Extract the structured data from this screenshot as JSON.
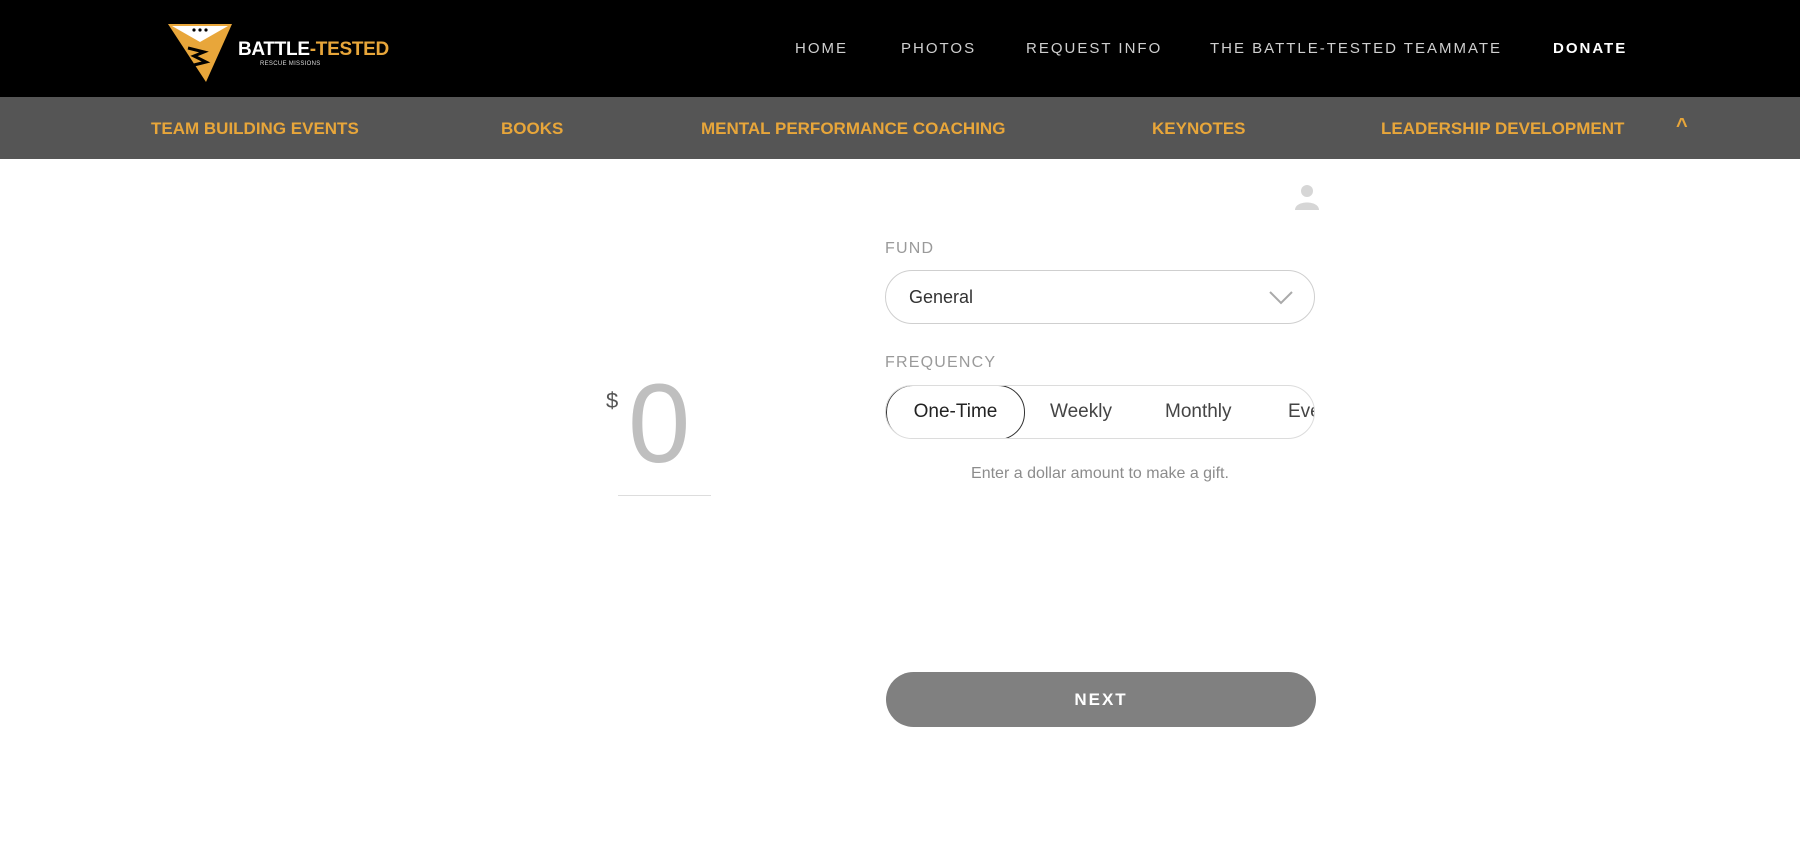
{
  "brand": {
    "name_part1": "BATTLE",
    "name_part2": "-TESTED",
    "tagline_part1": "RESCUE MISSIONS",
    "tagline_part2": ""
  },
  "main_nav": {
    "items": [
      {
        "label": "HOME"
      },
      {
        "label": "PHOTOS"
      },
      {
        "label": "REQUEST INFO"
      },
      {
        "label": "THE BATTLE-TESTED TEAMMATE"
      },
      {
        "label": "DONATE"
      }
    ]
  },
  "sub_nav": {
    "items": [
      {
        "label": "TEAM BUILDING EVENTS"
      },
      {
        "label": "BOOKS"
      },
      {
        "label": "MENTAL PERFORMANCE COACHING"
      },
      {
        "label": "KEYNOTES"
      },
      {
        "label": "LEADERSHIP DEVELOPMENT"
      }
    ],
    "caret": "^"
  },
  "donation": {
    "currency_symbol": "$",
    "amount": "0",
    "fund_label": "FUND",
    "fund_selected": "General",
    "frequency_label": "FREQUENCY",
    "frequency_options": [
      {
        "label": "One-Time"
      },
      {
        "label": "Weekly"
      },
      {
        "label": "Monthly"
      },
      {
        "label": "Eve"
      }
    ],
    "hint": "Enter a dollar amount to make a gift.",
    "next_label": "NEXT"
  },
  "colors": {
    "accent": "#e8a63a",
    "topbar": "#000000",
    "subbar": "#555555",
    "button": "#808080"
  },
  "icons": {
    "user": "user-icon",
    "fund_chevron": "chevron-down-icon",
    "logo": "shield-logo-icon"
  }
}
